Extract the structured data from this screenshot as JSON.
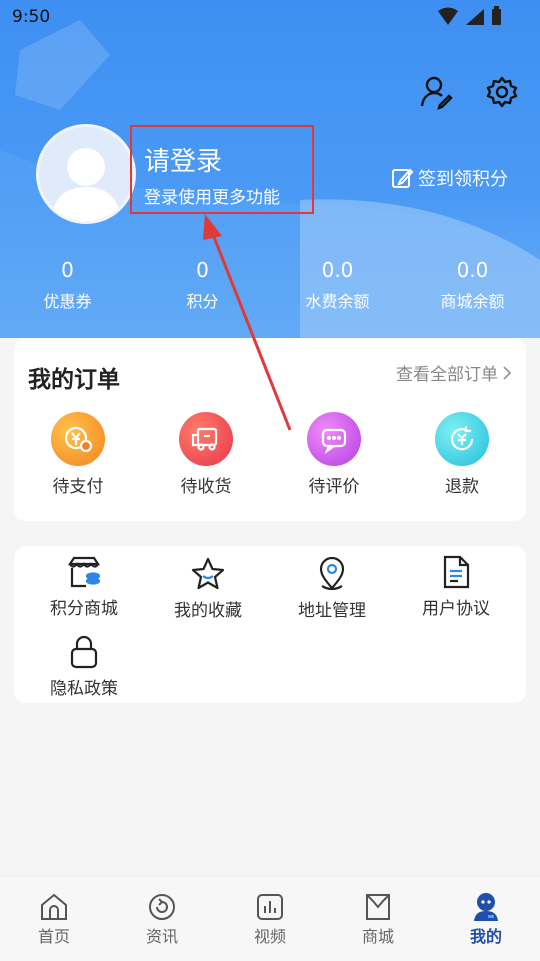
{
  "status_bar": {
    "time": "9:50"
  },
  "header": {
    "login_title": "请登录",
    "login_subtitle": "登录使用更多功能",
    "signin_label": "签到领积分",
    "stats": [
      {
        "value": "0",
        "label": "优惠券"
      },
      {
        "value": "0",
        "label": "积分"
      },
      {
        "value": "0.0",
        "label": "水费余额"
      },
      {
        "value": "0.0",
        "label": "商城余额"
      }
    ]
  },
  "orders": {
    "title": "我的订单",
    "view_all": "查看全部订单",
    "items": [
      {
        "label": "待支付",
        "icon": "pending-payment-icon"
      },
      {
        "label": "待收货",
        "icon": "delivery-truck-icon"
      },
      {
        "label": "待评价",
        "icon": "review-chat-icon"
      },
      {
        "label": "退款",
        "icon": "refund-icon"
      }
    ]
  },
  "services": {
    "items": [
      {
        "label": "积分商城",
        "icon": "points-store-icon"
      },
      {
        "label": "我的收藏",
        "icon": "star-icon"
      },
      {
        "label": "地址管理",
        "icon": "location-pin-icon"
      },
      {
        "label": "用户协议",
        "icon": "document-icon"
      },
      {
        "label": "隐私政策",
        "icon": "lock-icon"
      }
    ]
  },
  "tabbar": {
    "items": [
      {
        "label": "首页",
        "icon": "home-icon"
      },
      {
        "label": "资讯",
        "icon": "news-icon"
      },
      {
        "label": "视频",
        "icon": "video-icon"
      },
      {
        "label": "商城",
        "icon": "shopping-bag-icon"
      },
      {
        "label": "我的",
        "icon": "profile-icon",
        "active": true
      }
    ]
  },
  "colors": {
    "header_blue": "#3e8ff2",
    "highlight_red": "#e0393a",
    "active_tab": "#1f4fa8"
  }
}
